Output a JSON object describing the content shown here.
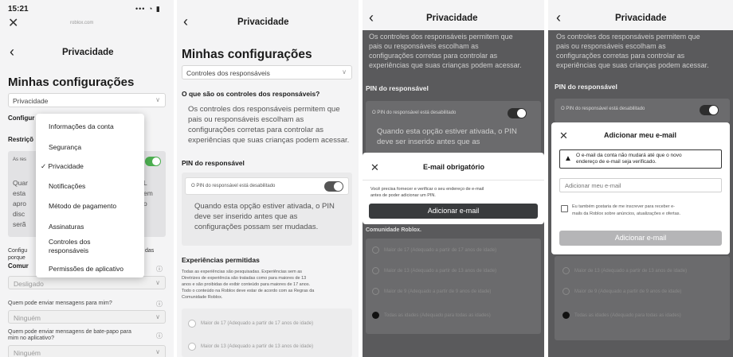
{
  "panel1": {
    "status_time": "15:21",
    "status_icons": "••• ◔ ▮",
    "url": "roblox.com",
    "nav_title": "Privacidade",
    "heading": "Minhas configurações",
    "select_value": "Privacidade",
    "label_config_partial": "Configur",
    "label_restric_partial": "Restriçõ",
    "row_partial": "As res",
    "para_fragments": [
      "Quar",
      "esta",
      "apro",
      "disc",
      "serã"
    ],
    "para_right": [
      "L",
      "em",
      "o"
    ],
    "config_partial": "Configu",
    "config_partial2": "porque",
    "comun_partial": "Comur",
    "config_right": "das",
    "menu": {
      "items": [
        {
          "label": "Informações da conta",
          "selected": false
        },
        {
          "label": "Segurança",
          "selected": false
        },
        {
          "label": "✓ Privacidade",
          "selected": true
        },
        {
          "label": "Notificações",
          "selected": false
        },
        {
          "label": "Método de pagamento",
          "selected": false
        },
        {
          "label": "Assinaturas",
          "selected": false
        },
        {
          "label": "Controles dos",
          "label2": "responsáveis",
          "selected": false
        },
        {
          "label": "Permissões de aplicativo",
          "selected": false
        }
      ]
    },
    "desligado": "Desligado",
    "q1": "Quem pode enviar mensagens para mim?",
    "q1_value": "Ninguém",
    "q2_line1": "Quem pode enviar mensagens de bate-papo para",
    "q2_line2": "mim no aplicativo?",
    "q2_value": "Ninguém"
  },
  "panel2": {
    "nav_title": "Privacidade",
    "heading": "Minhas configurações",
    "select_value": "Controles dos responsáveis",
    "section1": "O que são os controles dos responsáveis?",
    "para1": [
      "Os controles dos responsáveis permitem que",
      "pais ou responsáveis escolham as",
      "configurações corretas para controlar as",
      "experiências que suas crianças podem acessar."
    ],
    "section2": "PIN do responsável",
    "pin_status": "O PIN do responsável está desabilitado",
    "pin_para": [
      "Quando esta opção estiver ativada, o PIN",
      "deve ser inserido antes que as",
      "configurações possam ser mudadas."
    ],
    "section3": "Experiências permitidas",
    "exp_para": [
      "Todas as experiências são pesquisadas. Experiências sem as",
      "Diretrizes de experiência são tratadas como para maiores de 13",
      "anos e são proibidas de exibir conteúdo para maiores de 17 anos.",
      "Todo o conteúdo na Roblox deve estar de acordo com as Regras da",
      "Comunidade Roblox."
    ],
    "options": [
      "Maior de 17 (Adequado a partir de 17 anos de idade)",
      "Maior de 13 (Adequado a partir de 13 anos de idade)"
    ]
  },
  "panel3": {
    "nav_title": "Privacidade",
    "para1": [
      "Os controles dos responsáveis permitem que",
      "pais ou responsáveis escolham as",
      "configurações corretas para controlar as",
      "experiências que suas crianças podem acessar."
    ],
    "section2": "PIN do responsável",
    "pin_status": "O PIN do responsável está desabilitado",
    "pin_para": [
      "Quando esta opção estiver ativada, o PIN",
      "deve ser inserido antes que as"
    ],
    "modal": {
      "title": "E-mail obrigatório",
      "body": [
        "Você precisa fornecer e verificar o seu endereço de e-mail",
        "antes de poder adicionar um PIN."
      ],
      "button": "Adicionar e-mail"
    },
    "comunidade": "Comunidade Roblox.",
    "options": [
      "Maior de 17 (Adequado a partir de 17 anos de idade)",
      "Maior de 13 (Adequado a partir de 13 anos de idade)",
      "Maior de 9 (Adequado a partir de 9 anos de idade)",
      "Todas as idades (Adequado para todas as idades)"
    ]
  },
  "panel4": {
    "nav_title": "Privacidade",
    "para1": [
      "Os controles dos responsáveis permitem que",
      "pais ou responsáveis escolham as",
      "configurações corretas para controlar as",
      "experiências que suas crianças podem acessar."
    ],
    "section2": "PIN do responsável",
    "pin_status": "O PIN do responsável está desabilitado",
    "modal": {
      "title": "Adicionar meu e-mail",
      "warning": [
        "O e-mail da conta não mudará até que o novo",
        "endereço de e-mail seja verificado."
      ],
      "placeholder": "Adicionar meu e-mail",
      "checkbox": [
        "Eu também gostaria de me inscrever para receber e-",
        "mails da Roblox sobre anúncios, atualizações e ofertas."
      ],
      "button": "Adicionar e-mail"
    },
    "options": [
      "Maior de 13 (Adequado a partir de 13 anos de idade)",
      "Maior de 9 (Adequado a partir de 9 anos de idade)",
      "Todas as idades (Adequado para todas as idades)"
    ]
  },
  "colors": {
    "toggle_on": "#4caf50",
    "button_dark": "#393b3d",
    "overlay": "#5a5a5c"
  }
}
